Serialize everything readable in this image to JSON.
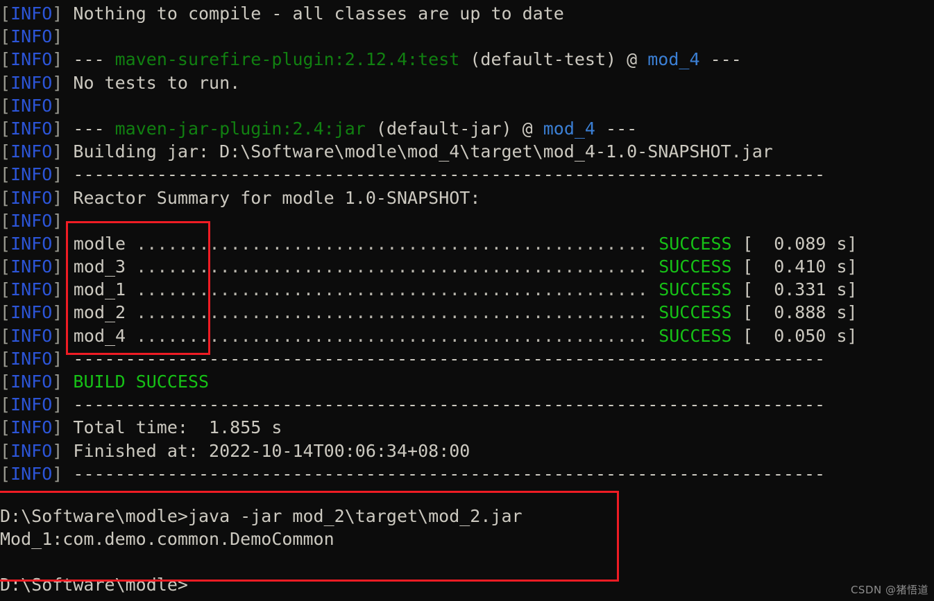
{
  "terminal": {
    "prefix": "[INFO]",
    "prefix_open": "[",
    "prefix_label": "INFO",
    "prefix_close": "]",
    "separator": " ------------------------------------------------------------------------",
    "colors": {
      "background": "#0c0c0c",
      "foreground": "#ccc9c0",
      "info_blue": "#2c55d8",
      "bracket_gray": "#9b9b92",
      "plugin_green": "#118011",
      "success_green": "#16c116",
      "module_blue": "#3b7fd4",
      "annotation_red": "#ef1c24"
    },
    "lines": [
      {
        "type": "text",
        "text": " Nothing to compile - all classes are up to date"
      },
      {
        "type": "empty",
        "text": ""
      },
      {
        "type": "goal",
        "dashes_left": " --- ",
        "goal": "maven-surefire-plugin:2.12.4:test",
        "exec": " (default-test) @ ",
        "module": "mod_4",
        "dashes_right": " ---"
      },
      {
        "type": "text",
        "text": " No tests to run."
      },
      {
        "type": "empty",
        "text": ""
      },
      {
        "type": "goal",
        "dashes_left": " --- ",
        "goal": "maven-jar-plugin:2.4:jar",
        "exec": " (default-jar) @ ",
        "module": "mod_4",
        "dashes_right": " ---"
      },
      {
        "type": "text",
        "text": " Building jar: D:\\Software\\modle\\mod_4\\target\\mod_4-1.0-SNAPSHOT.jar"
      },
      {
        "type": "separator",
        "text": " ------------------------------------------------------------------------"
      },
      {
        "type": "text",
        "text": " Reactor Summary for modle 1.0-SNAPSHOT:"
      },
      {
        "type": "empty",
        "text": ""
      },
      {
        "type": "reactor",
        "name": "modle",
        "dots": " .................................................",
        "status": "SUCCESS",
        "time": "[  0.089 s]"
      },
      {
        "type": "reactor",
        "name": "mod_3",
        "dots": " .................................................",
        "status": "SUCCESS",
        "time": "[  0.410 s]"
      },
      {
        "type": "reactor",
        "name": "mod_1",
        "dots": " .................................................",
        "status": "SUCCESS",
        "time": "[  0.331 s]"
      },
      {
        "type": "reactor",
        "name": "mod_2",
        "dots": " .................................................",
        "status": "SUCCESS",
        "time": "[  0.888 s]"
      },
      {
        "type": "reactor",
        "name": "mod_4",
        "dots": " .................................................",
        "status": "SUCCESS",
        "time": "[  0.050 s]"
      },
      {
        "type": "separator",
        "text": " ------------------------------------------------------------------------"
      },
      {
        "type": "build",
        "text": " BUILD SUCCESS"
      },
      {
        "type": "separator",
        "text": " ------------------------------------------------------------------------"
      },
      {
        "type": "text",
        "text": " Total time:  1.855 s"
      },
      {
        "type": "text",
        "text": " Finished at: 2022-10-14T00:06:34+08:00"
      },
      {
        "type": "separator",
        "text": " ------------------------------------------------------------------------"
      }
    ]
  },
  "command_block": {
    "prompt_line": "D:\\Software\\modle>java -jar mod_2\\target\\mod_2.jar",
    "prompt_path": "D:\\Software\\modle>",
    "command": "java -jar mod_2\\target\\mod_2.jar",
    "output_line": "Mod_1:com.demo.common.DemoCommon",
    "blank_line": ""
  },
  "tail": {
    "prompt": "D:\\Software\\modle>"
  },
  "annotations": {
    "module_box_label": "reactor-modules-highlight",
    "command_box_label": "java-run-command-highlight"
  },
  "watermark": {
    "text": "CSDN @猪悟道"
  }
}
